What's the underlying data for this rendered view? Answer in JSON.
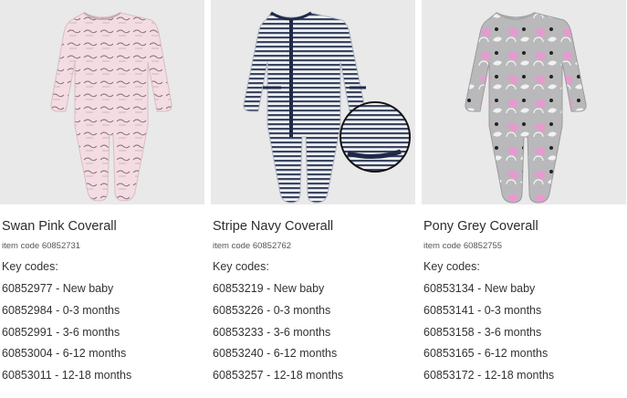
{
  "products": [
    {
      "name": "Swan Pink Coverall",
      "item_code": "item code 60852731",
      "key_codes_label": "Key codes:",
      "key_codes": [
        "60852977 - New baby",
        "60852984 - 0-3 months",
        "60852991 - 3-6 months",
        "60853004 - 6-12 months",
        "60853011 - 12-18 months"
      ],
      "colors": {
        "body": "#f3dde3",
        "accent": "#7a6068",
        "trim": "#f3dde3"
      }
    },
    {
      "name": "Stripe Navy Coverall",
      "item_code": "item code 60852762",
      "key_codes_label": "Key codes:",
      "key_codes": [
        "60853219 - New baby",
        "60853226 - 0-3 months",
        "60853233 - 3-6 months",
        "60853240 - 6-12 months",
        "60853257 - 12-18 months"
      ],
      "colors": {
        "body": "#eef0f3",
        "accent": "#2b3550",
        "trim": "#1f2a48"
      }
    },
    {
      "name": "Pony Grey Coverall",
      "item_code": "item code 60852755",
      "key_codes_label": "Key codes:",
      "key_codes": [
        "60853134 - New baby",
        "60853141 - 0-3 months",
        "60853158 - 3-6 months",
        "60853165 - 6-12 months",
        "60853172 - 12-18 months"
      ],
      "colors": {
        "body": "#b9b8ba",
        "accent": "#e79ad0",
        "trim": "#b9b8ba"
      }
    }
  ]
}
